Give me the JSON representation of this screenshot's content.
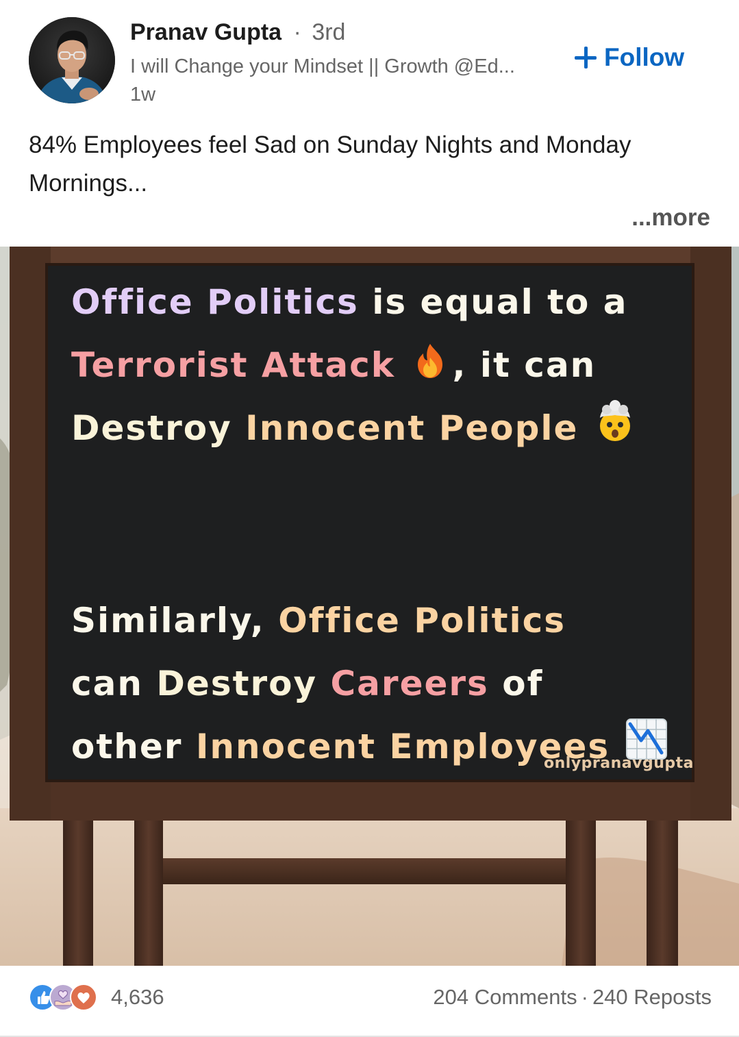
{
  "author": {
    "name": "Pranav Gupta",
    "separator": "·",
    "degree": "3rd",
    "headline": "I will Change your Mindset || Growth @Ed...",
    "time": "1w"
  },
  "follow_label": "Follow",
  "post": {
    "text": "84% Employees feel Sad on Sunday Nights and Monday Mornings...",
    "see_more": "...more"
  },
  "image": {
    "board_lines": [
      [
        {
          "text": "Office Politics ",
          "color": "lav"
        },
        {
          "text": "is equal to a",
          "color": "white"
        }
      ],
      [
        {
          "text": "Terrorist Attack ",
          "color": "pink"
        },
        {
          "emoji": "fire-emoji"
        },
        {
          "text": ", it can",
          "color": "white"
        }
      ],
      [
        {
          "text": "Destroy ",
          "color": "cream"
        },
        {
          "text": "Innocent People ",
          "color": "peach"
        },
        {
          "emoji": "exploding-head-emoji"
        }
      ],
      [
        {
          "text": "Similarly, ",
          "color": "white"
        },
        {
          "text": "Office Politics",
          "color": "peach"
        }
      ],
      [
        {
          "text": "can ",
          "color": "white"
        },
        {
          "text": "Destroy ",
          "color": "cream"
        },
        {
          "text": "Careers ",
          "color": "pink"
        },
        {
          "text": "of",
          "color": "white"
        }
      ],
      [
        {
          "text": "other ",
          "color": "white"
        },
        {
          "text": "Innocent Employees ",
          "color": "peach"
        },
        {
          "emoji": "chart-decreasing-emoji"
        }
      ]
    ],
    "watermark": "onlypranavgupta"
  },
  "social": {
    "reaction_icons": [
      "like-reaction-icon",
      "support-reaction-icon",
      "love-reaction-icon"
    ],
    "reactions_count": "4,636",
    "comments": "204 Comments",
    "separator": "·",
    "reposts": "240 Reposts"
  },
  "colors": {
    "accent": "#0a66c2",
    "board": "#1e1f20",
    "frame": "#4a2f22"
  }
}
